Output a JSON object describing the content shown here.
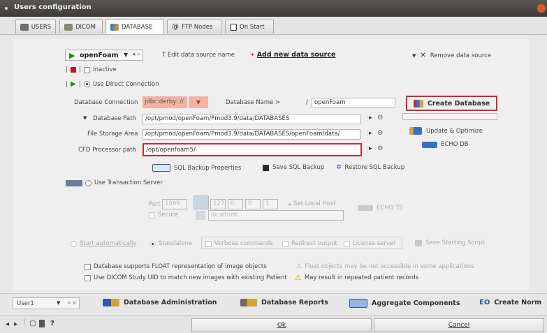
{
  "window": {
    "title": "Users configuration"
  },
  "tabs": [
    {
      "label": "USERS"
    },
    {
      "label": "DICOM"
    },
    {
      "label": "DATABASE"
    },
    {
      "label": "FTP Nodes"
    },
    {
      "label": "On Start"
    }
  ],
  "datasource": {
    "selected": "openFoam",
    "edit_label": "T Edit data source name",
    "add_label": "Add new data source",
    "remove_label": "Remove data source"
  },
  "inactive_label": "Inactive",
  "direct_label": "Use Direct Connection",
  "db_connection": {
    "label": "Database Connection",
    "value": "jdbc:derby: //"
  },
  "db_name": {
    "label": "Database Name >",
    "prefix": "/",
    "value": "openFoam"
  },
  "create_db_label": "Create Database",
  "db_path": {
    "label": "Database Path",
    "value": "/opt/pmod/openFoam/Pmod3.9/data/DATABASES"
  },
  "file_storage": {
    "label": "File Storage Area",
    "value": "/opt/pmod/openFoam/Pmod3.9/data/DATABASES/openFoam/data/"
  },
  "cfd_path": {
    "label": "CFD Processor path",
    "value": "/opt/openfoam5/"
  },
  "update_label": "Update & Optimize",
  "echo_db_label": "ECHO DB",
  "sql": {
    "backup_props": "SQL Backup Properties",
    "save_backup": "Save SQL Backup",
    "restore_backup": "Restore SQL Backup"
  },
  "transaction_label": "Use Transaction Server",
  "port": {
    "label": "Port",
    "value": "1099",
    "ip": [
      "127",
      "0",
      "0",
      "1"
    ]
  },
  "set_local_host_label": "Set Local Host",
  "echo_ts_label": "ECHO TS",
  "secure_label": "Secure",
  "localhost_value": "localhost",
  "start": {
    "label": "Start automatically",
    "standalone": "Standalone",
    "verbose": "Verbose commands",
    "redirect": "Redirect output",
    "license": "License server",
    "save_script": "Save Starting Script"
  },
  "options": {
    "float_label": "Database supports FLOAT representation of image objects",
    "float_warning": "Float objects may be not accessible in some applications",
    "dicom_uid_label": "Use DICOM Study UID to match new images with existing Patient",
    "dicom_warning": "May result in repeated patient records"
  },
  "bottom": {
    "user": "User1",
    "db_admin": "Database Administration",
    "db_reports": "Database Reports",
    "aggregate": "Aggregate Components",
    "create_norm": "Create Norm"
  },
  "status": {
    "question": "?",
    "ok": "Ok",
    "cancel": "Cancel"
  },
  "colors": {
    "titlebar": "#3d3b37",
    "highlight_red": "#d0272f",
    "green_play": "#1f8a1f",
    "accent_blue": "#2f5aa8"
  }
}
